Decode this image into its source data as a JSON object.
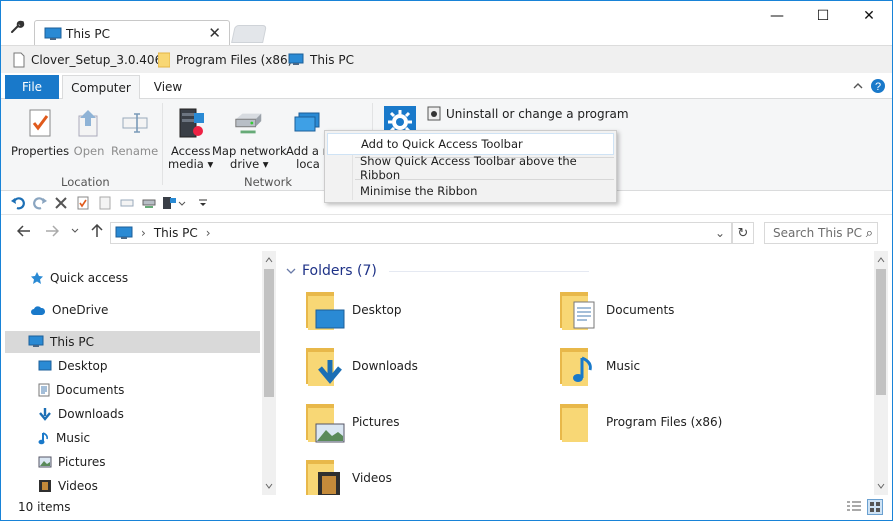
{
  "window": {
    "tab_title": "This PC",
    "tab_close": "✕",
    "minimize": "—",
    "maximize": "☐",
    "close": "✕"
  },
  "favorites": [
    {
      "label": "Clover_Setup_3.0.406",
      "icon": "file-icon"
    },
    {
      "label": "Program Files (x86)",
      "icon": "folder-icon"
    },
    {
      "label": "This PC",
      "icon": "monitor-icon"
    }
  ],
  "ribbon_tabs": {
    "file": "File",
    "computer": "Computer",
    "view": "View"
  },
  "ribbon": {
    "location_group": "Location",
    "network_group": "Network",
    "properties": "Properties",
    "open": "Open",
    "rename": "Rename",
    "access_media_l1": "Access",
    "access_media_l2": "media ▾",
    "map_drive_l1": "Map network",
    "map_drive_l2": "drive ▾",
    "add_location_l1": "Add a n",
    "add_location_l2": "loca",
    "uninstall": "Uninstall or change a program"
  },
  "context_menu": {
    "items": [
      "Add to Quick Access Toolbar",
      "Show Quick Access Toolbar above the Ribbon",
      "Minimise the Ribbon"
    ]
  },
  "address": {
    "sep1": "›",
    "location": "This PC",
    "sep2": "›",
    "dropdown": "⌄",
    "refresh": "↻",
    "search_placeholder": "Search This PC",
    "search_icon": "⌕"
  },
  "nav_pane": [
    {
      "label": "Quick access",
      "icon": "star-icon"
    },
    {
      "label": "OneDrive",
      "icon": "cloud-icon"
    },
    {
      "label": "This PC",
      "icon": "monitor-icon",
      "selected": true
    },
    {
      "label": "Desktop",
      "icon": "desktop-icon"
    },
    {
      "label": "Documents",
      "icon": "documents-icon"
    },
    {
      "label": "Downloads",
      "icon": "download-icon"
    },
    {
      "label": "Music",
      "icon": "music-icon"
    },
    {
      "label": "Pictures",
      "icon": "pictures-icon"
    },
    {
      "label": "Videos",
      "icon": "videos-icon"
    }
  ],
  "content": {
    "group_header": "Folders (7)",
    "folders": [
      {
        "label": "Desktop",
        "overlay": "desktop"
      },
      {
        "label": "Documents",
        "overlay": "documents"
      },
      {
        "label": "Downloads",
        "overlay": "downloads"
      },
      {
        "label": "Music",
        "overlay": "music"
      },
      {
        "label": "Pictures",
        "overlay": "pictures"
      },
      {
        "label": "Program Files (x86)",
        "overlay": "none"
      },
      {
        "label": "Videos",
        "overlay": "videos"
      }
    ]
  },
  "status": {
    "item_count": "10 items"
  },
  "colors": {
    "accent": "#1979ca",
    "folder": "#f8d775",
    "folder_dark": "#e8b84a",
    "header_text": "#1e3287"
  }
}
